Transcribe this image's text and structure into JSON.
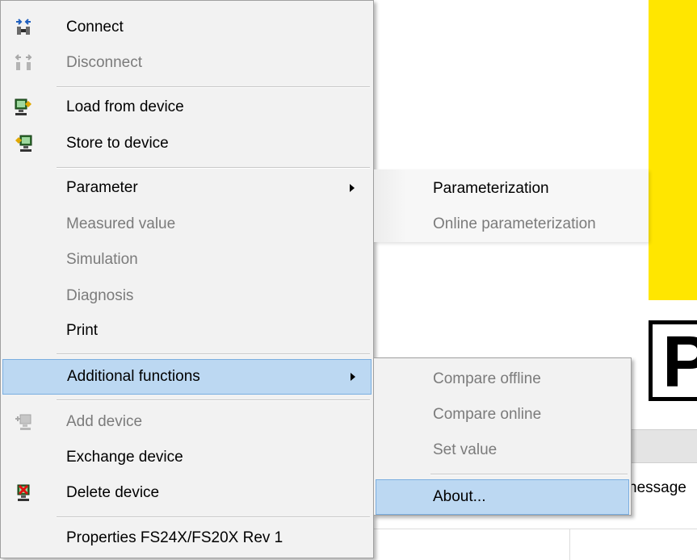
{
  "background": {
    "big_letter": "P",
    "partial_text": "nessage",
    "accent_color": "#ffe600"
  },
  "context_menu": {
    "items": [
      {
        "label": "Connect",
        "enabled": true,
        "icon": "connect-icon"
      },
      {
        "label": "Disconnect",
        "enabled": false,
        "icon": "disconnect-icon"
      },
      {
        "label": "Load from device",
        "enabled": true,
        "icon": "load-from-device-icon"
      },
      {
        "label": "Store to device",
        "enabled": true,
        "icon": "store-to-device-icon"
      },
      {
        "label": "Parameter",
        "enabled": true,
        "submenu": true
      },
      {
        "label": "Measured value",
        "enabled": false
      },
      {
        "label": "Simulation",
        "enabled": false
      },
      {
        "label": "Diagnosis",
        "enabled": false
      },
      {
        "label": "Print",
        "enabled": true
      },
      {
        "label": "Additional functions",
        "enabled": true,
        "submenu": true,
        "highlighted": true
      },
      {
        "label": "Add device",
        "enabled": false,
        "icon": "add-device-icon"
      },
      {
        "label": "Exchange device",
        "enabled": true
      },
      {
        "label": "Delete device",
        "enabled": true,
        "icon": "delete-device-icon"
      },
      {
        "label": "Properties FS24X/FS20X Rev 1",
        "enabled": true
      }
    ]
  },
  "parameter_submenu": {
    "items": [
      {
        "label": "Parameterization",
        "enabled": true
      },
      {
        "label": "Online parameterization",
        "enabled": false
      }
    ]
  },
  "additional_functions_submenu": {
    "items": [
      {
        "label": "Compare offline",
        "enabled": false
      },
      {
        "label": "Compare online",
        "enabled": false
      },
      {
        "label": "Set value",
        "enabled": false
      },
      {
        "label": "About...",
        "enabled": true,
        "highlighted": true
      }
    ]
  },
  "colors": {
    "menu_background": "#f2f2f2",
    "highlight": "#bcd8f2",
    "highlight_border": "#7aaee0",
    "disabled_text": "#7b7b7b"
  }
}
